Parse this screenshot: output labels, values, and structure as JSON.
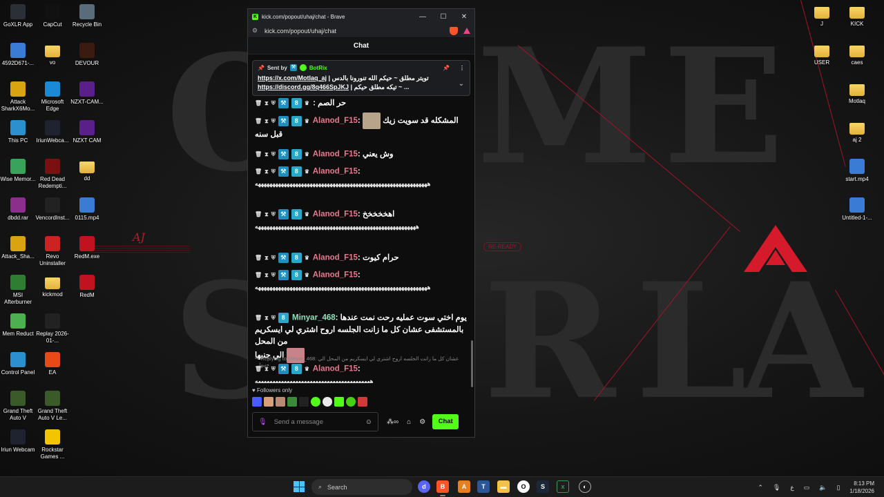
{
  "desktop": {
    "left_icons": [
      {
        "label": "GoXLR App",
        "icon": "goxlr-icon",
        "color": "#2b2f36"
      },
      {
        "label": "CapCut",
        "icon": "capcut-icon",
        "color": "#111111"
      },
      {
        "label": "Recycle Bin",
        "icon": "recycle-bin-icon",
        "color": "#5a6b7a"
      },
      {
        "label": "4592D671-...",
        "icon": "file-icon",
        "color": "#3a7bd5"
      },
      {
        "label": "vo",
        "icon": "folder-icon",
        "color": "#e3b23c"
      },
      {
        "label": "DEVOUR",
        "icon": "devour-icon",
        "color": "#3b1a0f"
      },
      {
        "label": "Attack SharkX6Mo...",
        "icon": "attack-shark-icon",
        "color": "#d9a410"
      },
      {
        "label": "Microsoft Edge",
        "icon": "edge-icon",
        "color": "#1b8ad6"
      },
      {
        "label": "NZXT-CAM...",
        "icon": "nzxt-icon",
        "color": "#5b1f8c"
      },
      {
        "label": "This PC",
        "icon": "this-pc-icon",
        "color": "#2c8fd0"
      },
      {
        "label": "IriunWebca...",
        "icon": "iriun-icon",
        "color": "#1f2330"
      },
      {
        "label": "NZXT CAM",
        "icon": "nzxt-icon",
        "color": "#5b1f8c"
      },
      {
        "label": "Wise Memor...",
        "icon": "wise-memory-icon",
        "color": "#3aa35b"
      },
      {
        "label": "Red Dead Redempti...",
        "icon": "rdr-icon",
        "color": "#7a1111"
      },
      {
        "label": "dd",
        "icon": "folder-icon",
        "color": "#e3b23c"
      },
      {
        "label": "dbdd.rar",
        "icon": "rar-icon",
        "color": "#8c2e8c"
      },
      {
        "label": "VencordInst...",
        "icon": "vencord-icon",
        "color": "#222222"
      },
      {
        "label": "0115.mp4",
        "icon": "video-file-icon",
        "color": "#3a7bd5"
      },
      {
        "label": "Attack_Sha...",
        "icon": "attack-shark-icon",
        "color": "#d9a410"
      },
      {
        "label": "Revo Uninstaller",
        "icon": "revo-icon",
        "color": "#c22"
      },
      {
        "label": "RedM.exe",
        "icon": "redm-icon",
        "color": "#c0121f"
      },
      {
        "label": "MSI Afterburner",
        "icon": "msi-icon",
        "color": "#2e7d32"
      },
      {
        "label": "kickmod",
        "icon": "folder-icon",
        "color": "#e3b23c"
      },
      {
        "label": "RedM",
        "icon": "redm-icon",
        "color": "#c0121f"
      },
      {
        "label": "Mem Reduct",
        "icon": "mem-reduct-icon",
        "color": "#4caf50"
      },
      {
        "label": "Replay 2026-01-...",
        "icon": "replay-icon",
        "color": "#222"
      },
      {
        "label": "Control Panel",
        "icon": "control-panel-icon",
        "color": "#2c8fd0"
      },
      {
        "label": "EA",
        "icon": "ea-icon",
        "color": "#e64a19"
      },
      {
        "label": "Grand Theft Auto V",
        "icon": "gta-icon",
        "color": "#3a5a2a"
      },
      {
        "label": "Grand Theft Auto V Le...",
        "icon": "gta-icon",
        "color": "#3a5a2a"
      },
      {
        "label": "Iriun Webcam",
        "icon": "iriun-icon",
        "color": "#1f2330"
      },
      {
        "label": "Rockstar Games ...",
        "icon": "rockstar-icon",
        "color": "#f5c400"
      }
    ],
    "right_icons": [
      {
        "label": "J",
        "icon": "folder-icon"
      },
      {
        "label": "KICK",
        "icon": "folder-icon"
      },
      {
        "label": "USER",
        "icon": "folder-icon"
      },
      {
        "label": "caes",
        "icon": "folder-icon"
      },
      {
        "label": "Motlaq",
        "icon": "folder-icon"
      },
      {
        "label": "aj 2",
        "icon": "folder-icon"
      },
      {
        "label": "start.mp4",
        "icon": "video-file-icon"
      },
      {
        "label": "Untitled-1-...",
        "icon": "video-file-icon"
      }
    ],
    "wallpaper_text_aj": "AJ",
    "wallpaper_ready": "RE-READY"
  },
  "browser": {
    "title": "kick.com/popout/uhaj/chat - Brave",
    "url": "kick.com/popout/uhaj/chat",
    "controls": {
      "minimize": "—",
      "maximize": "☐",
      "close": "✕"
    }
  },
  "chat": {
    "header": "Chat",
    "pinned": {
      "sent_by_label": "Sent by",
      "sender": "BotRix",
      "text_rtl": "| تويتر مطلق ~ حيكم الله تنورونا بالدس",
      "link1": "https://x.com/Motlaq_aj",
      "link2": "https://discord.gg/8q466SpJKJ",
      "text2_rtl": "| تيكه مطلق حيكم ~",
      "ellipsis": "..."
    },
    "partial_top": "حر الصم :",
    "messages": [
      {
        "user": "Alanod_F15",
        "text": "المشكله قد سويت زيك",
        "text2": "قبل سنه"
      },
      {
        "user": "Alanod_F15",
        "text": "وش يعني"
      },
      {
        "user": "Alanod_F15",
        "text": "",
        "long": "ههههههههههههههههههههههههههههههههههههههههههههههههههههههههههههه"
      },
      {
        "user": "Alanod_F15",
        "text": "اهخخخخخ",
        "long": "ههههههههههههههههههههههههههههههههههههههههههههههههههههههههه"
      },
      {
        "user": "Alanod_F15",
        "text": "حرام كيوت"
      },
      {
        "user": "Alanod_F15",
        "text": "",
        "long": "ههههههههههههههههههههههههههههههههههههههههههههههههههههههههههههه"
      },
      {
        "user": "Minyar_468",
        "text": "يوم اختي سوت عمليه رحت نمت عندها",
        "text2": "بالمستشفى عشان كل ما زانت الجلسه اروح اشتري لي ايسكريم من المحل",
        "text3": "الي جنبها"
      },
      {
        "user": "Alanod_F15",
        "text": "",
        "long": "ههههههههههههههههههههههههههههههههههههههههه"
      }
    ],
    "reply_label": "Replying to Minyar_468:",
    "reply_snippet": "عشان كل ما زانت الجلسه اروح اشتري لي ايسكريم من المحل الي جنبها...",
    "followers_only": "Followers only",
    "input_placeholder": "Send a message",
    "send_button": "Chat"
  },
  "taskbar": {
    "search_label": "Search",
    "lang": "ع",
    "time": "8:13 PM",
    "date": "1/18/2026"
  }
}
